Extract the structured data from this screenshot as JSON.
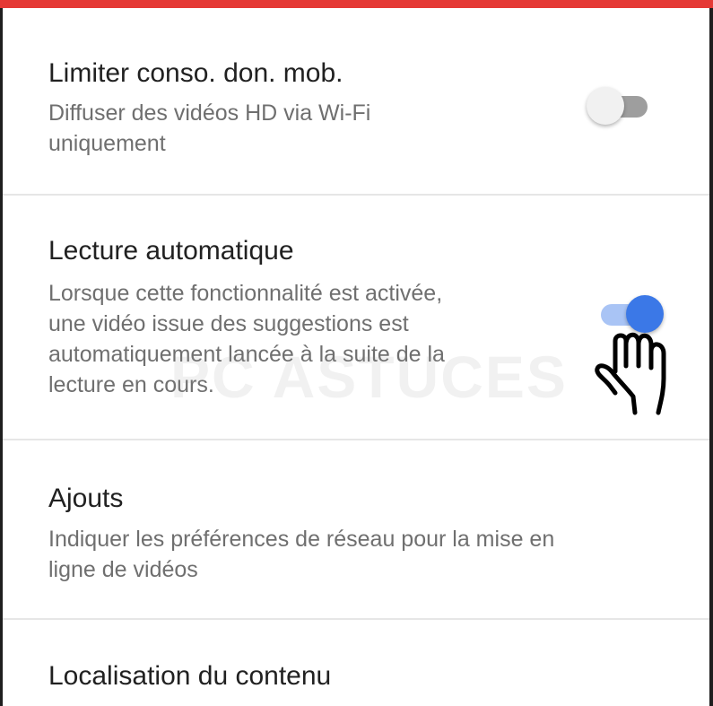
{
  "settings": {
    "items": [
      {
        "title": "Limiter conso. don. mob.",
        "description_lines": [
          "Diffuser des vidéos HD via Wi-Fi",
          "uniquement"
        ],
        "toggle": "off"
      },
      {
        "title": "Lecture automatique",
        "description_lines": [
          "Lorsque cette fonctionnalité est activée,",
          "une vidéo issue des suggestions est",
          "automatiquement lancée à la suite de la",
          "lecture en cours."
        ],
        "toggle": "on"
      },
      {
        "title": "Ajouts",
        "description_lines": [
          "Indiquer les préférences de réseau pour la mise en",
          "ligne de vidéos"
        ]
      },
      {
        "title": "Localisation du contenu"
      }
    ]
  },
  "watermark": {
    "text": "PC ASTUCES"
  },
  "icons": {
    "cursor": "hand-pointer-icon"
  },
  "colors": {
    "accent_bar": "#e53935",
    "toggle_on": "#3b78e7",
    "toggle_on_track": "#a9c4f5",
    "toggle_off_thumb": "#f1f1f1",
    "toggle_off_track": "#9e9e9e"
  }
}
